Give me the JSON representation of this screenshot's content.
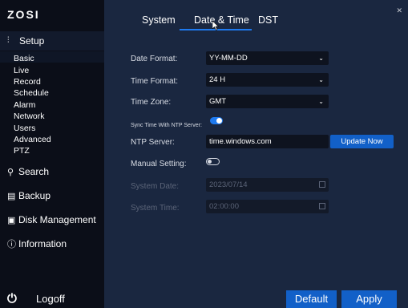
{
  "brand": "ZOSI",
  "sidebar": {
    "setup_label": "Setup",
    "setup_icon": "sliders-icon",
    "sub_items": [
      "Basic",
      "Live",
      "Record",
      "Schedule",
      "Alarm",
      "Network",
      "Users",
      "Advanced",
      "PTZ"
    ],
    "selected_sub": "Basic",
    "nav": [
      {
        "label": "Search",
        "icon": "search-icon"
      },
      {
        "label": "Backup",
        "icon": "backup-icon"
      },
      {
        "label": "Disk Management",
        "icon": "disk-icon"
      },
      {
        "label": "Information",
        "icon": "info-icon"
      }
    ],
    "logoff_label": "Logoff"
  },
  "tabs": [
    {
      "label": "System",
      "active": false
    },
    {
      "label": "Date & Time",
      "active": true
    },
    {
      "label": "DST",
      "active": false
    }
  ],
  "form": {
    "date_format_label": "Date Format:",
    "date_format_value": "YY-MM-DD",
    "time_format_label": "Time Format:",
    "time_format_value": "24 H",
    "time_zone_label": "Time Zone:",
    "time_zone_value": "GMT",
    "sync_label": "Sync Time With NTP Server:",
    "sync_enabled": true,
    "ntp_label": "NTP Server:",
    "ntp_value": "time.windows.com",
    "update_now_label": "Update Now",
    "manual_label": "Manual Setting:",
    "manual_enabled": false,
    "system_date_label": "System Date:",
    "system_date_value": "2023/07/14",
    "system_time_label": "System Time:",
    "system_time_value": "02:00:00"
  },
  "footer": {
    "default_label": "Default",
    "apply_label": "Apply"
  },
  "colors": {
    "accent": "#1e7af0",
    "button": "#1260c8",
    "sidebar_bg": "#0b0e18",
    "panel_bg": "#1a2740"
  }
}
